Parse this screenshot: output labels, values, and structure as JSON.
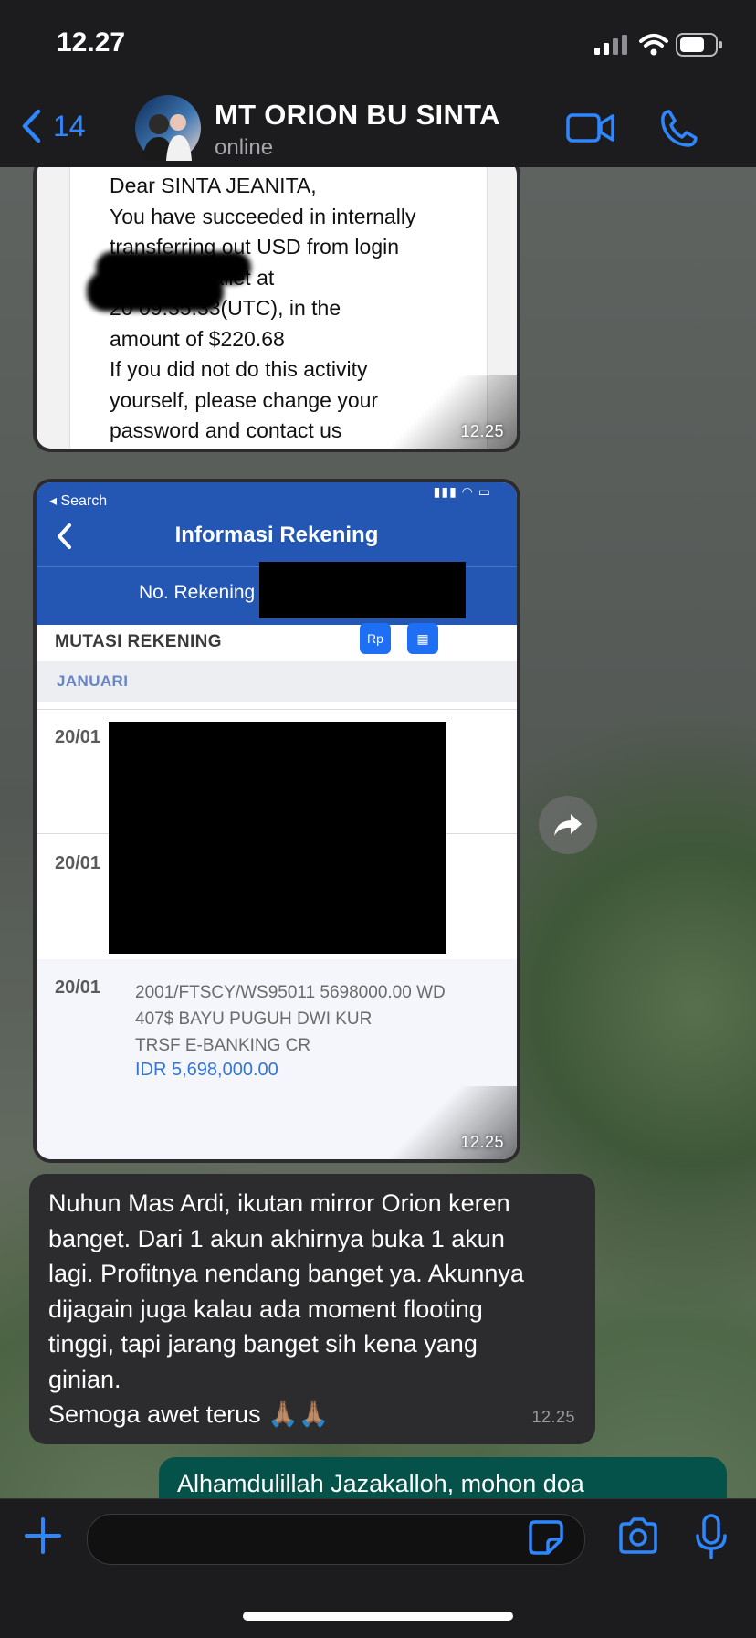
{
  "status_bar": {
    "time": "12.27"
  },
  "header": {
    "back_count": "14",
    "contact_name": "MT ORION BU SINTA",
    "status": "online"
  },
  "messages": {
    "email_image": {
      "text": "Dear SINTA JEANITA,\nYou have succeeded in internally\ntransferring out USD from login\n2          to your wallet at\n20         09:35:33(UTC), in the\namount of $220.68\nIf you did not do this activity\nyourself, please change your\npassword and contact us\nimmediately",
      "time": "12.25"
    },
    "bank_image": {
      "search_back": "◂ Search",
      "title": "Informasi Rekening",
      "rekening_label": "No. Rekening",
      "mutasi_label": "MUTASI REKENING",
      "month": "JANUARI",
      "dates": [
        "20/01",
        "20/01",
        "20/01"
      ],
      "last_desc_1": "2001/FTSCY/WS95011 5698000.00 WD",
      "last_desc_2": "407$ BAYU PUGUH DWI KUR",
      "last_desc_3": "TRSF E-BANKING CR",
      "last_amount": "IDR 5,698,000.00",
      "time": "12.25"
    },
    "incoming_text": {
      "text": "Nuhun Mas Ardi, ikutan mirror Orion keren banget. Dari 1 akun akhirnya buka 1 akun lagi. Profitnya nendang banget ya. Akunnya dijagain juga kalau ada moment flooting tinggi, tapi jarang banget sih kena yang ginian.\nSemoga awet terus 🙏🏽🙏🏽",
      "time": "12.25"
    },
    "outgoing_text": {
      "text": "Alhamdulillah Jazakalloh, mohon doa"
    }
  },
  "input_bar": {
    "placeholder": ""
  },
  "icons": {
    "back": "chevron-left-icon",
    "video": "video-call-icon",
    "phone": "phone-icon",
    "forward": "forward-icon",
    "plus": "plus-icon",
    "sticker": "sticker-icon",
    "camera": "camera-icon",
    "mic": "microphone-icon"
  },
  "colors": {
    "accent": "#2f87ff",
    "bubble_in": "#2c2c2e",
    "bubble_out": "#05524a",
    "bank_blue": "#2456b3"
  }
}
